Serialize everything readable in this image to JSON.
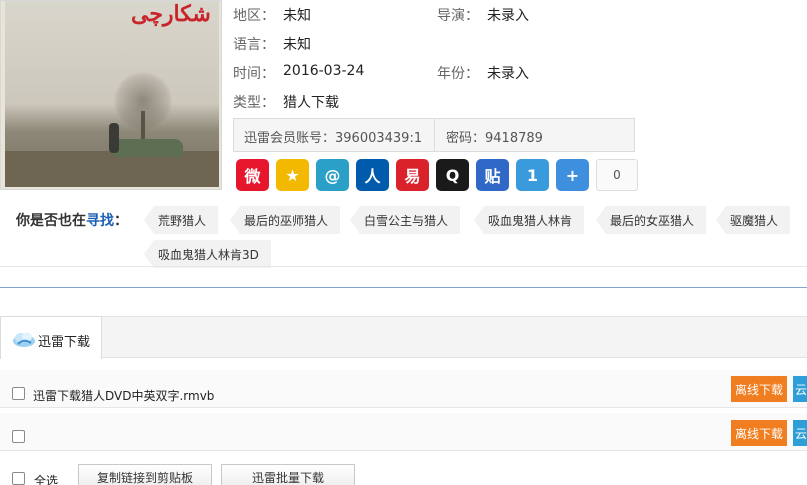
{
  "poster": {
    "title_art": "شکارچی",
    "icon": "movie-poster-image"
  },
  "info": {
    "region_label": "地区：",
    "region_value": "未知",
    "director_label": "导演：",
    "director_value": "未录入",
    "language_label": "语言：",
    "language_value": "未知",
    "time_label": "时间：",
    "time_value": "2016-03-24",
    "year_label": "年份：",
    "year_value": "未录入",
    "type_label": "类型：",
    "type_value": "猎人下载"
  },
  "account": {
    "account_text": "迅雷会员账号：396003439:1",
    "password_text": "密码：9418789"
  },
  "share": {
    "icons": [
      {
        "name": "weibo-icon",
        "glyph": "微",
        "color": "#e6162d"
      },
      {
        "name": "qzone-icon",
        "glyph": "★",
        "color": "#f3b800"
      },
      {
        "name": "tencent-weibo-icon",
        "glyph": "@",
        "color": "#2aa0c9"
      },
      {
        "name": "renren-icon",
        "glyph": "人",
        "color": "#005bac"
      },
      {
        "name": "netease-icon",
        "glyph": "易",
        "color": "#d9222a"
      },
      {
        "name": "qq-icon",
        "glyph": "Q",
        "color": "#1a1a1a"
      },
      {
        "name": "tieba-icon",
        "glyph": "贴",
        "color": "#2f68c7"
      },
      {
        "name": "kaixin-icon",
        "glyph": "1",
        "color": "#3a9bdc"
      },
      {
        "name": "more-share-icon",
        "glyph": "+",
        "color": "#3e8fdd"
      }
    ],
    "count": "0"
  },
  "seek": {
    "prefix": "你是否也在",
    "highlight": "寻找",
    "suffix": "：",
    "tags": [
      "荒野猎人",
      "最后的巫师猎人",
      "白雪公主与猎人",
      "吸血鬼猎人林肯",
      "最后的女巫猎人",
      "驱魔猎人",
      "吸血鬼猎人林肯3D"
    ]
  },
  "download": {
    "tab_label": "迅雷下载",
    "rows": [
      {
        "file": "迅雷下载猎人DVD中英双字.rmvb",
        "offline": "离线下载",
        "cloud": "云"
      },
      {
        "file": "",
        "offline": "离线下载",
        "cloud": "云"
      }
    ],
    "select_all": "全选",
    "copy_links": "复制链接到剪贴板",
    "batch_download": "迅雷批量下载"
  }
}
